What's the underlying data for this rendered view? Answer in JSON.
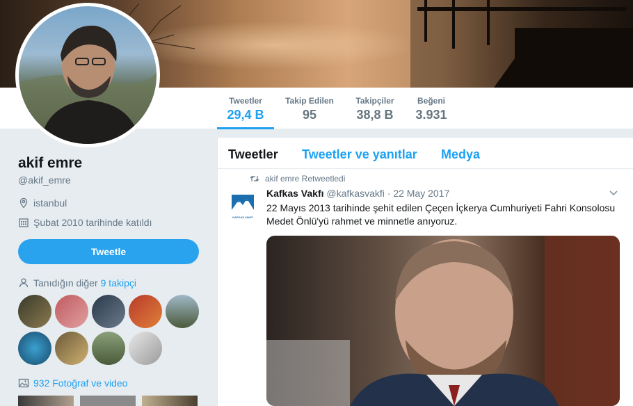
{
  "profile": {
    "name": "akif emre",
    "handle": "@akif_emre",
    "location": "istanbul",
    "joined": "Şubat 2010 tarihinde katıldı",
    "tweet_button": "Tweetle",
    "known_followers_prefix": "Tanıdığın diğer",
    "known_followers_link": "9 takipçi",
    "photos_link": "932 Fotoğraf ve video"
  },
  "stats": [
    {
      "label": "Tweetler",
      "value": "29,4 B",
      "active": true
    },
    {
      "label": "Takip Edilen",
      "value": "95",
      "active": false
    },
    {
      "label": "Takipçiler",
      "value": "38,8 B",
      "active": false
    },
    {
      "label": "Beğeni",
      "value": "3.931",
      "active": false
    }
  ],
  "tabs": [
    "Tweetler",
    "Tweetler ve yanıtlar",
    "Medya"
  ],
  "tweet": {
    "retweet_context": "akif emre Retweetledi",
    "author_name": "Kafkas Vakfı",
    "author_handle": "@kafkasvakfi",
    "separator": "·",
    "date": "22 May 2017",
    "text": "22 Mayıs 2013 tarihinde şehit edilen Çeçen İçkerya Cumhuriyeti Fahri Konsolosu Medet Önlü'yü rahmet ve minnetle anıyoruz.",
    "avatar_text": "KAFKAS VAKFI"
  },
  "colors": {
    "accent": "#1da1f2",
    "button": "#2aa3ef",
    "muted": "#657786",
    "background": "#e6ecf0"
  }
}
